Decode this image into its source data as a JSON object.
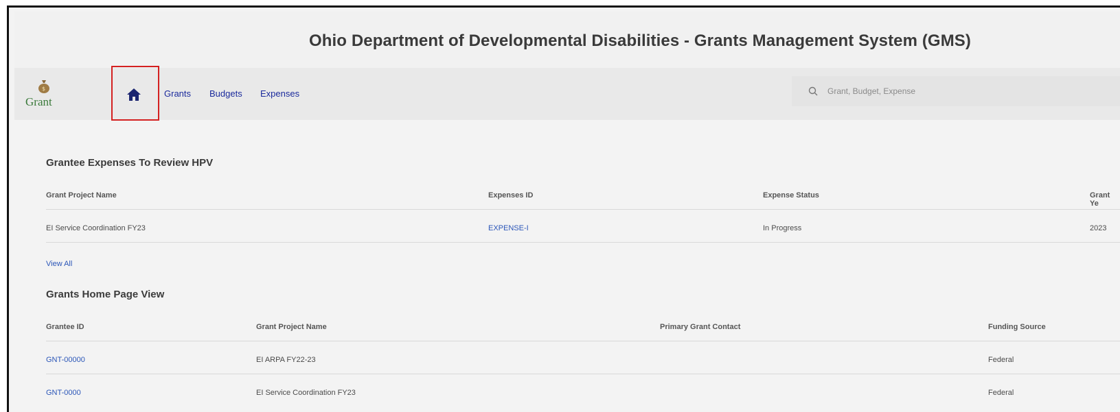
{
  "header": {
    "title": "Ohio Department of Developmental Disabilities - Grants Management System (GMS)"
  },
  "nav": {
    "logo_text": "Grant",
    "home_icon": "home-icon",
    "links": [
      "Grants",
      "Budgets",
      "Expenses"
    ]
  },
  "search": {
    "placeholder": "Grant, Budget, Expense"
  },
  "expenses_section": {
    "title": "Grantee Expenses To Review HPV",
    "columns": [
      "Grant Project Name",
      "Expenses ID",
      "Expense Status",
      "Grant Ye"
    ],
    "rows": [
      [
        "EI Service Coordination FY23",
        "EXPENSE-I",
        "In Progress",
        "2023"
      ]
    ],
    "view_all": "View All"
  },
  "grants_section": {
    "title": "Grants Home Page View",
    "columns": [
      "Grantee ID",
      "Grant Project Name",
      "Primary Grant Contact",
      "Funding Source"
    ],
    "rows": [
      [
        "GNT-00000",
        "EI ARPA FY22-23",
        "",
        "Federal"
      ],
      [
        "GNT-0000",
        "EI Service Coordination FY23",
        "",
        "Federal"
      ]
    ]
  },
  "colors": {
    "link": "#2b56b8",
    "nav_link": "#1a2a9c",
    "highlight_border": "#d42020"
  }
}
